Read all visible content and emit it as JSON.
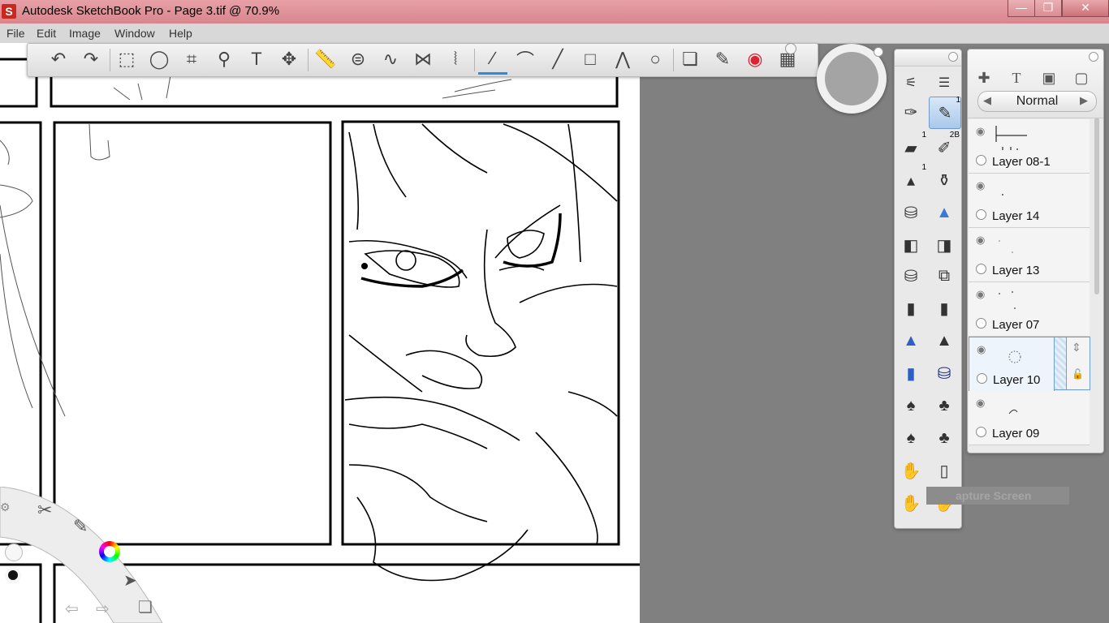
{
  "window": {
    "title": "Autodesk SketchBook Pro - Page 3.tif @ 70.9%",
    "app_icon_letter": "S",
    "controls": {
      "minimize": "—",
      "maximize": "❐",
      "close": "✕"
    }
  },
  "menu": [
    "File",
    "Edit",
    "Image",
    "Window",
    "Help"
  ],
  "toolbar": {
    "tools": [
      {
        "name": "undo-icon",
        "glyph": "↶"
      },
      {
        "name": "redo-icon",
        "glyph": "↷"
      },
      {
        "name": "rect-select-icon",
        "glyph": "⬚"
      },
      {
        "name": "lasso-icon",
        "glyph": "◯"
      },
      {
        "name": "crop-icon",
        "glyph": "⌗"
      },
      {
        "name": "zoom-icon",
        "glyph": "⚲"
      },
      {
        "name": "text-icon",
        "glyph": "T"
      },
      {
        "name": "move-icon",
        "glyph": "✥"
      },
      {
        "name": "ruler-icon",
        "glyph": "📏"
      },
      {
        "name": "ellipse-guide-icon",
        "glyph": "⊜"
      },
      {
        "name": "french-curve-icon",
        "glyph": "∿"
      },
      {
        "name": "symmetry-icon",
        "glyph": "⋈"
      },
      {
        "name": "symmetry-y-icon",
        "glyph": "⦚"
      },
      {
        "name": "freehand-stroke-icon",
        "glyph": "∕"
      },
      {
        "name": "curve-icon",
        "glyph": "⌒"
      },
      {
        "name": "line-icon",
        "glyph": "╱"
      },
      {
        "name": "rectangle-icon",
        "glyph": "□"
      },
      {
        "name": "polyline-icon",
        "glyph": "⋀"
      },
      {
        "name": "circle-icon",
        "glyph": "○"
      },
      {
        "name": "layers-toggle-icon",
        "glyph": "❏"
      },
      {
        "name": "brushes-toggle-icon",
        "glyph": "✎"
      },
      {
        "name": "color-wheel-icon",
        "glyph": "◉"
      },
      {
        "name": "palettes-icon",
        "glyph": "▦"
      }
    ]
  },
  "brush_palette": {
    "badges": [
      "1",
      "1",
      "1",
      "2B"
    ]
  },
  "layers": {
    "blend_mode": "Normal",
    "list": [
      {
        "name": "Layer 08-1",
        "selected": false
      },
      {
        "name": "Layer 14",
        "selected": false
      },
      {
        "name": "Layer 13",
        "selected": false
      },
      {
        "name": "Layer 07",
        "selected": false
      },
      {
        "name": "Layer 10",
        "selected": true
      },
      {
        "name": "Layer 09",
        "selected": false
      }
    ]
  },
  "tooltip": "apture Screen",
  "colors": {
    "titlebar": "#d8868d",
    "accent": "#2a8be0",
    "workspace": "#808080"
  }
}
